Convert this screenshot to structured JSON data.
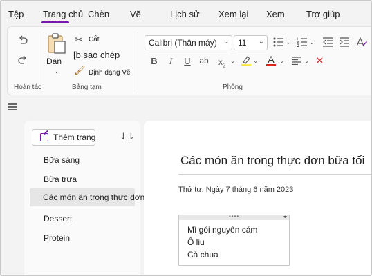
{
  "tabs": [
    "Tệp",
    "Trang chủ",
    "Chèn",
    "Vẽ",
    "Lịch sử",
    "Xem lại",
    "Xem",
    "Trợ giúp"
  ],
  "active_tab": "Trang chủ",
  "accent_color": "#7719aa",
  "ribbon": {
    "undo_group": {
      "label": "Hoàn tác",
      "undo_icon": "undo-icon",
      "redo_icon": "redo-icon"
    },
    "clipboard_group": {
      "label": "Bảng tạm",
      "paste": "Dán",
      "cut": "Cắt",
      "copy": "[b sao chép",
      "format_painter": "Định dạng Vẽ"
    },
    "font_group": {
      "label": "Phông",
      "font_name": "Calibri (Thân máy)",
      "font_size": "11",
      "bold": "B",
      "italic": "I",
      "underline": "U",
      "strike": "ab",
      "subscript": "x",
      "subscript_mark": "2",
      "font_color": "A",
      "clear": "✕"
    }
  },
  "page_list": {
    "add_page": "Thêm trang",
    "pages": [
      "Bữa sáng",
      "Bữa trưa",
      "Các món ăn trong thực đơn bữa tối",
      "Dessert",
      "Protein"
    ],
    "selected_index": 2
  },
  "page": {
    "title": "Các món ăn trong thực đơn bữa tối",
    "date": "Thứ tư. Ngày 7 tháng 6 năm 2023",
    "note_lines": [
      "Mì gói nguyên cám",
      "Ô liu",
      "Cà chua"
    ]
  }
}
